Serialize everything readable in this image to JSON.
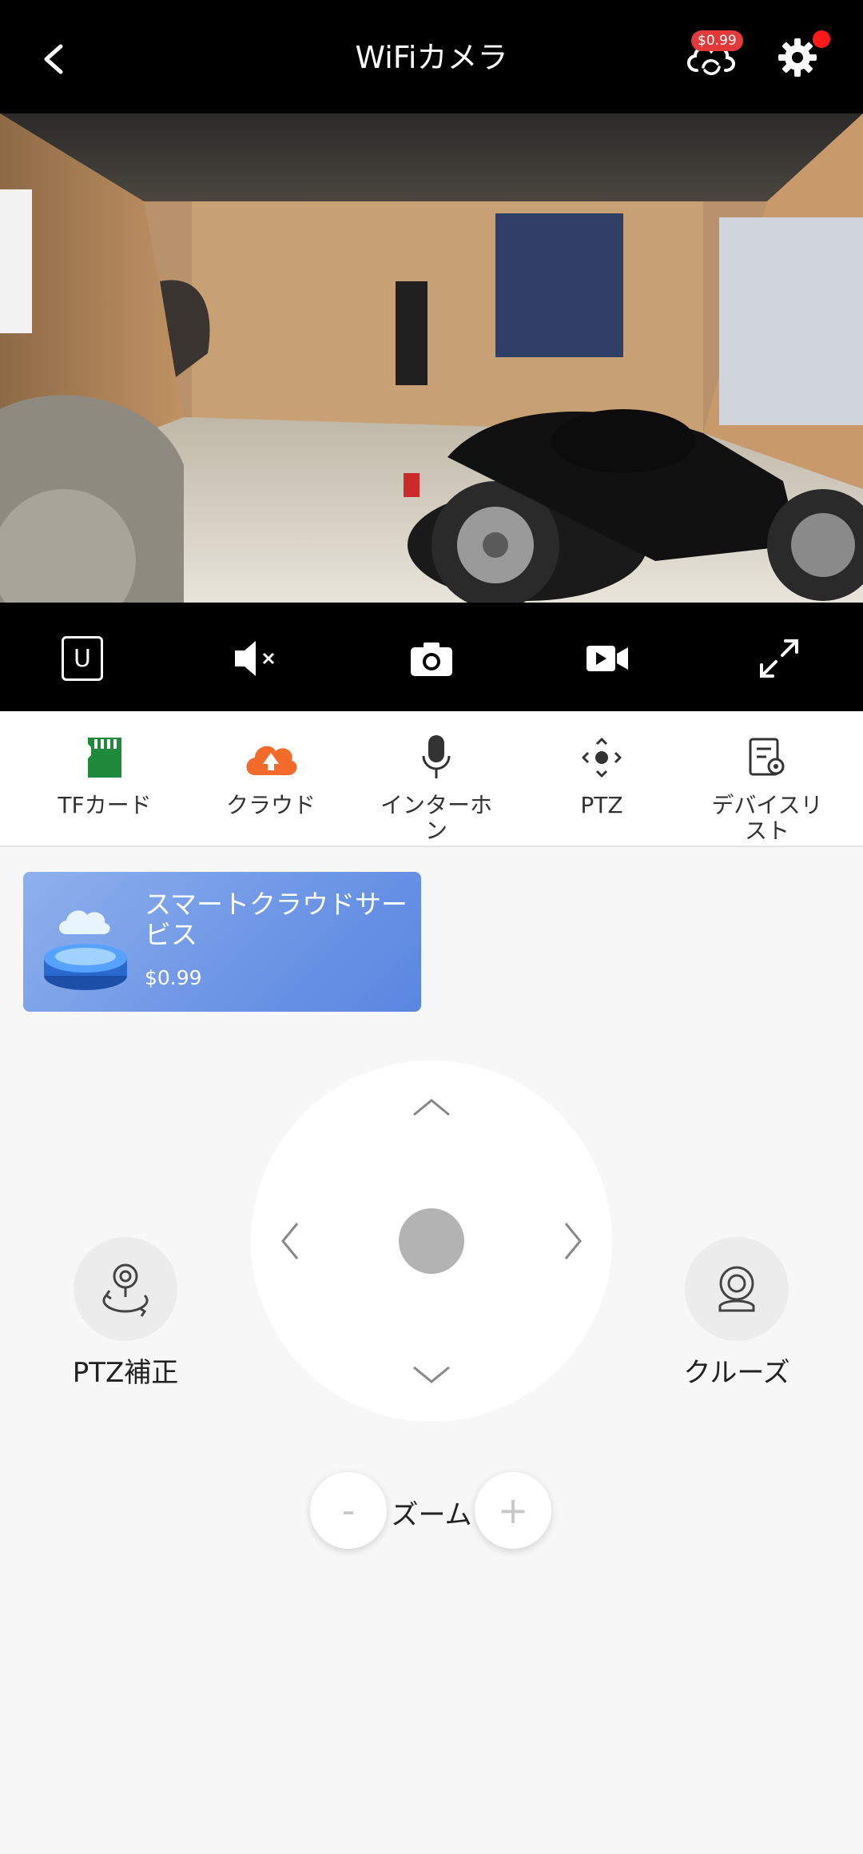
{
  "header": {
    "title": "WiFiカメラ",
    "cloud_price_badge": "$0.99",
    "back_icon": "chevron-left-icon",
    "cloud_icon": "cloud-sync-icon",
    "settings_icon": "gear-icon",
    "notification_dot_color": "#ff1a1a"
  },
  "controls": {
    "quality_label": "U",
    "items": [
      "quality-toggle",
      "mute-icon",
      "camera-snapshot-icon",
      "video-record-icon",
      "fullscreen-icon"
    ]
  },
  "features": [
    {
      "label": "TFカード",
      "icon": "sd-card-icon",
      "color": "#1f8a3b"
    },
    {
      "label": "クラウド",
      "icon": "cloud-upload-icon",
      "color": "#f26b2a"
    },
    {
      "label": "インターホン",
      "icon": "microphone-icon",
      "color": "#333333"
    },
    {
      "label": "PTZ",
      "icon": "ptz-direction-icon",
      "color": "#333333"
    },
    {
      "label": "デバイスリスト",
      "icon": "device-list-icon",
      "color": "#333333"
    }
  ],
  "promo": {
    "title": "スマートクラウドサービス",
    "price": "$0.99"
  },
  "ptz": {
    "calibrate_label": "PTZ補正",
    "cruise_label": "クルーズ"
  },
  "zoom": {
    "label": "ズーム",
    "minus": "-",
    "plus": "+"
  }
}
